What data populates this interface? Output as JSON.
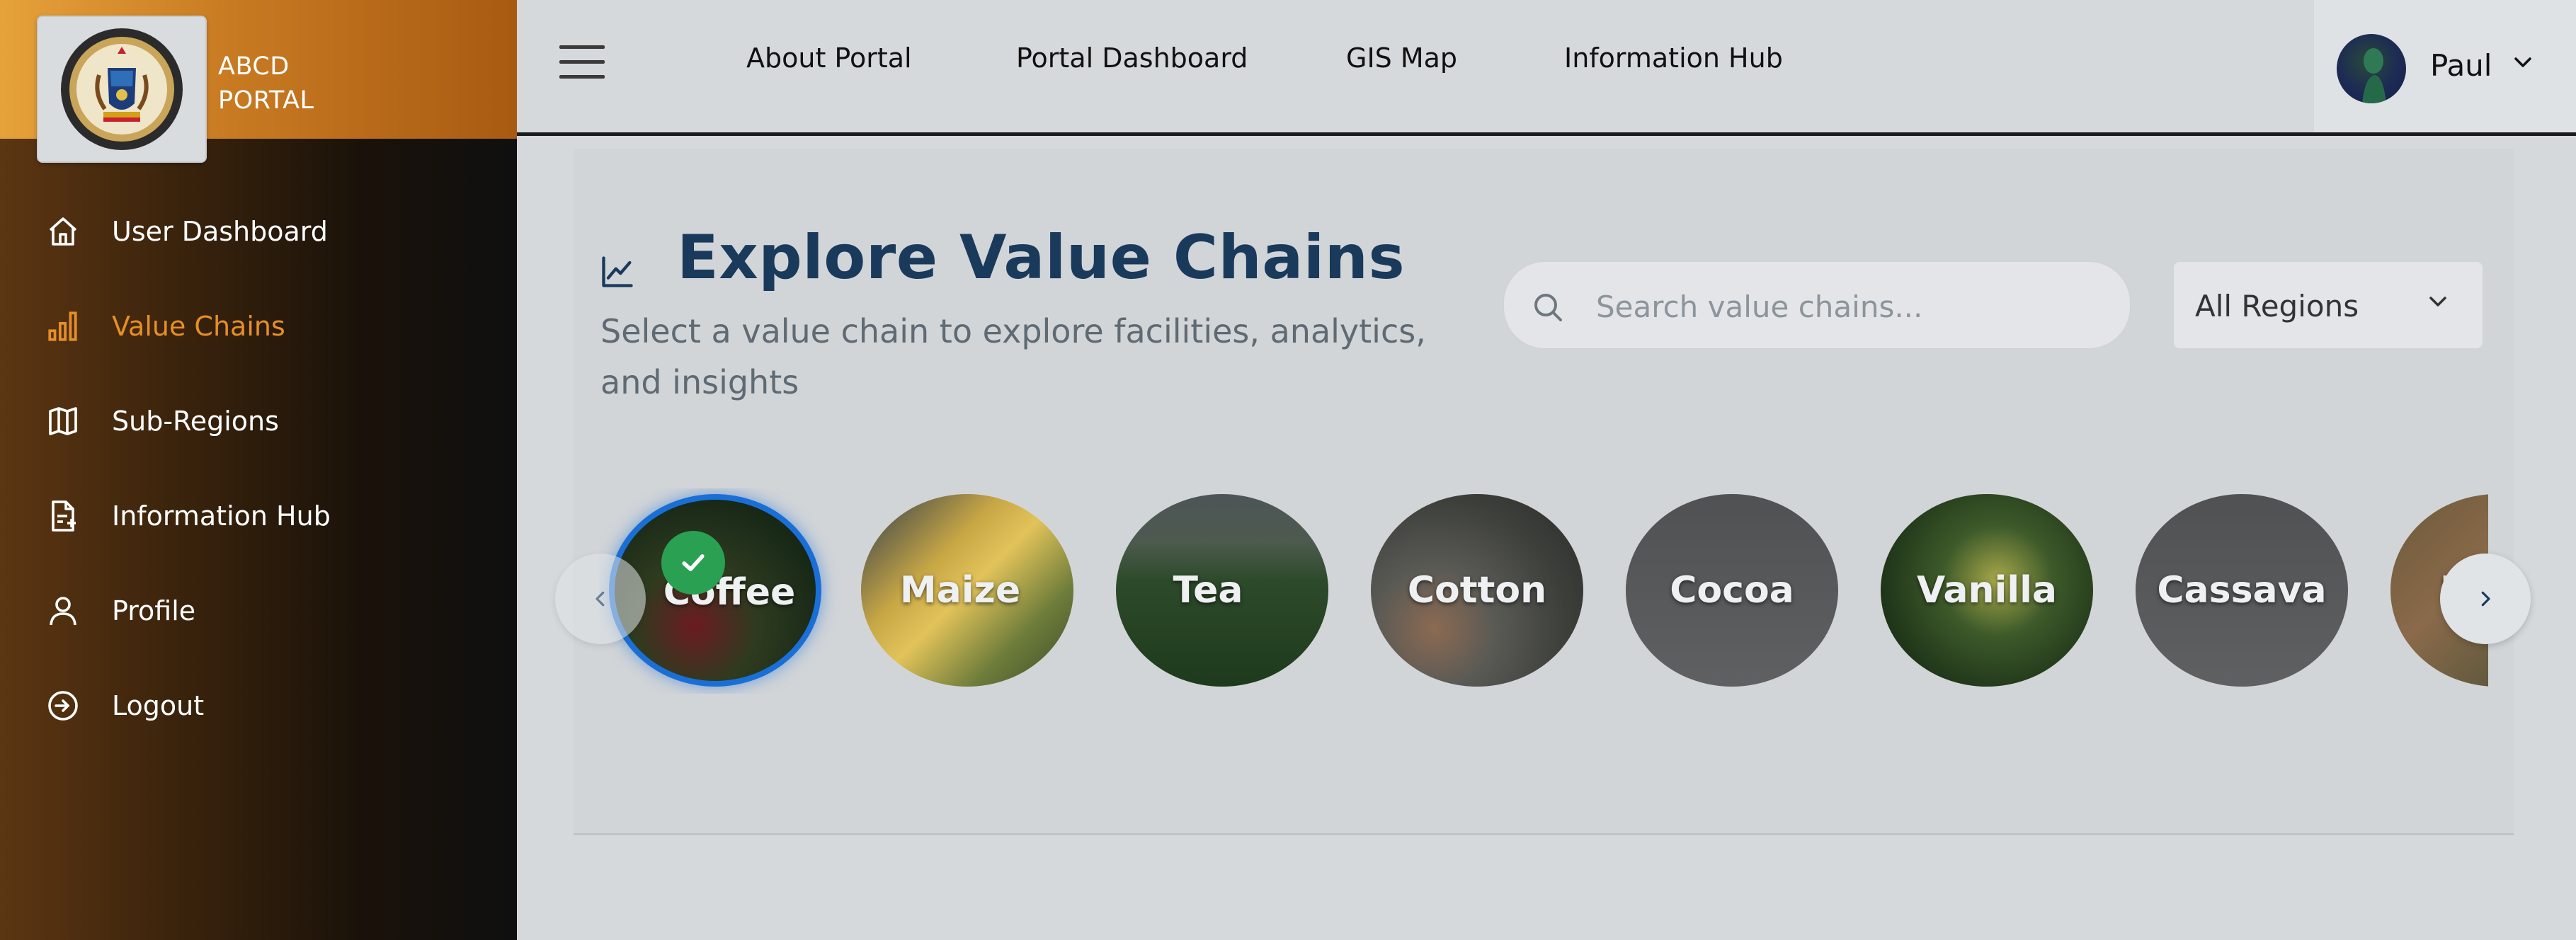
{
  "brand": {
    "line1": "ABCD",
    "line2": "PORTAL"
  },
  "sidebar": {
    "items": [
      {
        "label": "User Dashboard",
        "icon": "home-icon",
        "active": false
      },
      {
        "label": "Value Chains",
        "icon": "bar-chart-icon",
        "active": true
      },
      {
        "label": "Sub-Regions",
        "icon": "map-icon",
        "active": false
      },
      {
        "label": "Information Hub",
        "icon": "document-icon",
        "active": false
      },
      {
        "label": "Profile",
        "icon": "user-icon",
        "active": false
      },
      {
        "label": "Logout",
        "icon": "logout-icon",
        "active": false
      }
    ]
  },
  "topnav": {
    "items": [
      "About Portal",
      "Portal Dashboard",
      "GIS Map",
      "Information Hub"
    ]
  },
  "user": {
    "name": "Paul"
  },
  "main": {
    "title": "Explore Value Chains",
    "subtitle": "Select a value chain to explore facilities, analytics, and insights",
    "search_placeholder": "Search value chains...",
    "region_value": "All Regions",
    "chains": [
      {
        "label": "Coffee",
        "selected": true
      },
      {
        "label": "Maize",
        "selected": false
      },
      {
        "label": "Tea",
        "selected": false
      },
      {
        "label": "Cotton",
        "selected": false
      },
      {
        "label": "Cocoa",
        "selected": false
      },
      {
        "label": "Vanilla",
        "selected": false
      },
      {
        "label": "Cassava",
        "selected": false
      },
      {
        "label": "R",
        "selected": false
      }
    ]
  },
  "colors": {
    "accent": "#e68f26",
    "title": "#1a3a5c",
    "selected_ring": "#1a6fd6",
    "check": "#2aa052"
  }
}
